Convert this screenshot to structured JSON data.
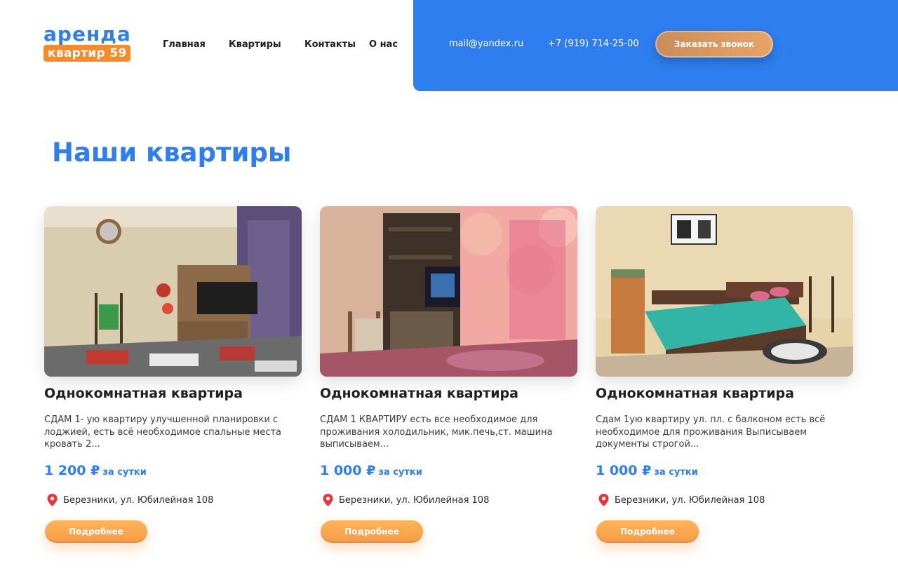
{
  "header": {
    "logo": {
      "line1": "аренда",
      "line2": "квартир 59"
    },
    "nav": [
      "Главная",
      "Квартиры",
      "Контакты",
      "О нас"
    ],
    "email": "mail@yandex.ru",
    "phone": "+7 (919) 714-25-00",
    "call_button": "Заказать звонок",
    "accent_color": "#2f7ef0"
  },
  "main": {
    "title": "Наши квартиры",
    "cards": [
      {
        "title": "Однокомнатная квартира",
        "description": "СДАМ 1- ую квартиру улучшенной планировки с лоджией, есть всё необходимое спальные места кровать 2...",
        "price": "1 200 ₽",
        "price_unit": "за сутки",
        "address": "Березники, ул. Юбилейная 108",
        "button": "Подробнее"
      },
      {
        "title": "Однокомнатная квартира",
        "description": "СДАМ 1 КВАРТИРУ есть все необходимое для проживания холодильник, мик.печь,ст. машина выписываем...",
        "price": "1 000 ₽",
        "price_unit": "за сутки",
        "address": "Березники, ул. Юбилейная 108",
        "button": "Подробнее"
      },
      {
        "title": "Однокомнатная квартира",
        "description": "Сдам 1ую квартиру ул. пл. с балконом есть всё необходимое для проживания Выписываем документы строгой...",
        "price": "1 000 ₽",
        "price_unit": "за сутки",
        "address": "Березники, ул. Юбилейная 108",
        "button": "Подробнее"
      }
    ]
  }
}
